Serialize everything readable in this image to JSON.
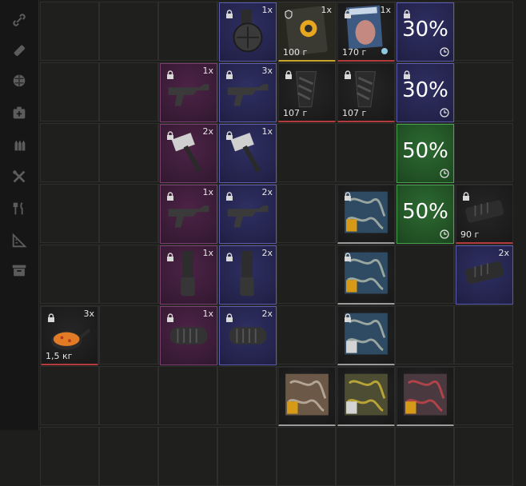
{
  "sidebar": {
    "items": [
      {
        "icon": "link-icon"
      },
      {
        "icon": "bandage-icon"
      },
      {
        "icon": "sphere-icon"
      },
      {
        "icon": "medkit-icon"
      },
      {
        "icon": "ammo-icon"
      },
      {
        "icon": "tools-icon"
      },
      {
        "icon": "food-icon"
      },
      {
        "icon": "ruler-icon"
      },
      {
        "icon": "box-icon"
      }
    ]
  },
  "items": [
    {
      "name": "drum-magazine",
      "count": "1x",
      "label": ""
    },
    {
      "name": "document-portal",
      "count": "1x",
      "label": "100 г"
    },
    {
      "name": "magazine",
      "count": "1x",
      "label": "170 г"
    },
    {
      "name": "armor-30-a",
      "count": "",
      "label": "",
      "percent": "30%"
    },
    {
      "name": "smg-purple-1",
      "count": "1x",
      "label": ""
    },
    {
      "name": "smg-blue-1",
      "count": "3x",
      "label": ""
    },
    {
      "name": "grip-1",
      "count": "",
      "label": "107 г"
    },
    {
      "name": "grip-2",
      "count": "",
      "label": "107 г"
    },
    {
      "name": "armor-30-b",
      "count": "",
      "label": "",
      "percent": "30%"
    },
    {
      "name": "hammer-purple",
      "count": "2x",
      "label": ""
    },
    {
      "name": "hammer-blue",
      "count": "1x",
      "label": ""
    },
    {
      "name": "armor-50-a",
      "count": "",
      "label": "",
      "percent": "50%"
    },
    {
      "name": "smg-purple-2",
      "count": "1x",
      "label": ""
    },
    {
      "name": "smg-blue-2",
      "count": "2x",
      "label": ""
    },
    {
      "name": "camo-1",
      "count": "",
      "label": ""
    },
    {
      "name": "armor-50-b",
      "count": "",
      "label": "",
      "percent": "50%"
    },
    {
      "name": "muzzle-1",
      "count": "",
      "label": "90 г"
    },
    {
      "name": "mag-purple",
      "count": "1x",
      "label": ""
    },
    {
      "name": "mag-blue",
      "count": "2x",
      "label": ""
    },
    {
      "name": "camo-2",
      "count": "",
      "label": ""
    },
    {
      "name": "muzzle-2",
      "count": "2x",
      "label": ""
    },
    {
      "name": "pan-food",
      "count": "3x",
      "label": "1,5 кг"
    },
    {
      "name": "brake-purple",
      "count": "1x",
      "label": ""
    },
    {
      "name": "brake-blue",
      "count": "2x",
      "label": ""
    },
    {
      "name": "camo-3",
      "count": "",
      "label": ""
    },
    {
      "name": "camo-4",
      "count": "",
      "label": ""
    },
    {
      "name": "camo-5",
      "count": "",
      "label": ""
    },
    {
      "name": "camo-6",
      "count": "",
      "label": ""
    }
  ]
}
